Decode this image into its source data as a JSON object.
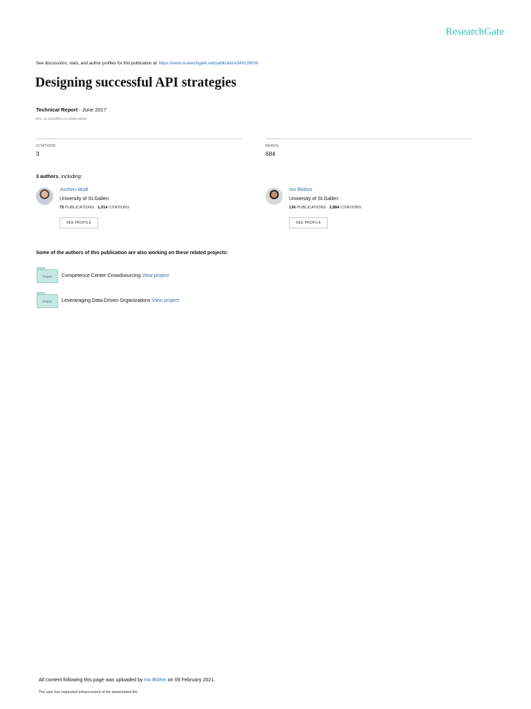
{
  "brand": {
    "name": "ResearchGate",
    "color": "#26c6b3"
  },
  "header": {
    "see_text": "See discussions, stats, and author profiles for this publication at:",
    "url": "https://www.researchgate.net/publication/349139026"
  },
  "publication": {
    "title": "Designing successful API strategies",
    "type": "Technical Report",
    "date_sep": " · ",
    "date": "June 2017",
    "doi": "DOI: 10.13140/RG.2.2.20624.88322"
  },
  "stats": {
    "citations_label": "CITATIONS",
    "citations_value": "3",
    "reads_label": "READS",
    "reads_value": "684"
  },
  "authors": {
    "count_bold": "3 authors",
    "count_rest": ", including:",
    "list": [
      {
        "name": "Jochen Wulf",
        "affiliation": "University of St.Gallen",
        "publications": "75",
        "publications_label": "PUBLICATIONS",
        "citations": "1,014",
        "citations_label": "CITATIONS",
        "button": "SEE PROFILE"
      },
      {
        "name": "Ivo Blohm",
        "affiliation": "University of St.Gallen",
        "publications": "136",
        "publications_label": "PUBLICATIONS",
        "citations": "2,884",
        "citations_label": "CITATIONS",
        "button": "SEE PROFILE"
      }
    ]
  },
  "related": {
    "heading": "Some of the authors of this publication are also working on these related projects:",
    "projects": [
      {
        "icon_label": "Project",
        "name": "Competence Center Crowdsourcing",
        "link": "View project"
      },
      {
        "icon_label": "Project",
        "name": "Leveraraging Data-Driven Organizations",
        "link": "View project"
      }
    ]
  },
  "footer": {
    "upload_prefix": "All content following this page was uploaded by",
    "uploader": "Ivo Blohm",
    "upload_suffix": "on 09 February 2021.",
    "enhancement": "The user has requested enhancement of the downloaded file."
  }
}
